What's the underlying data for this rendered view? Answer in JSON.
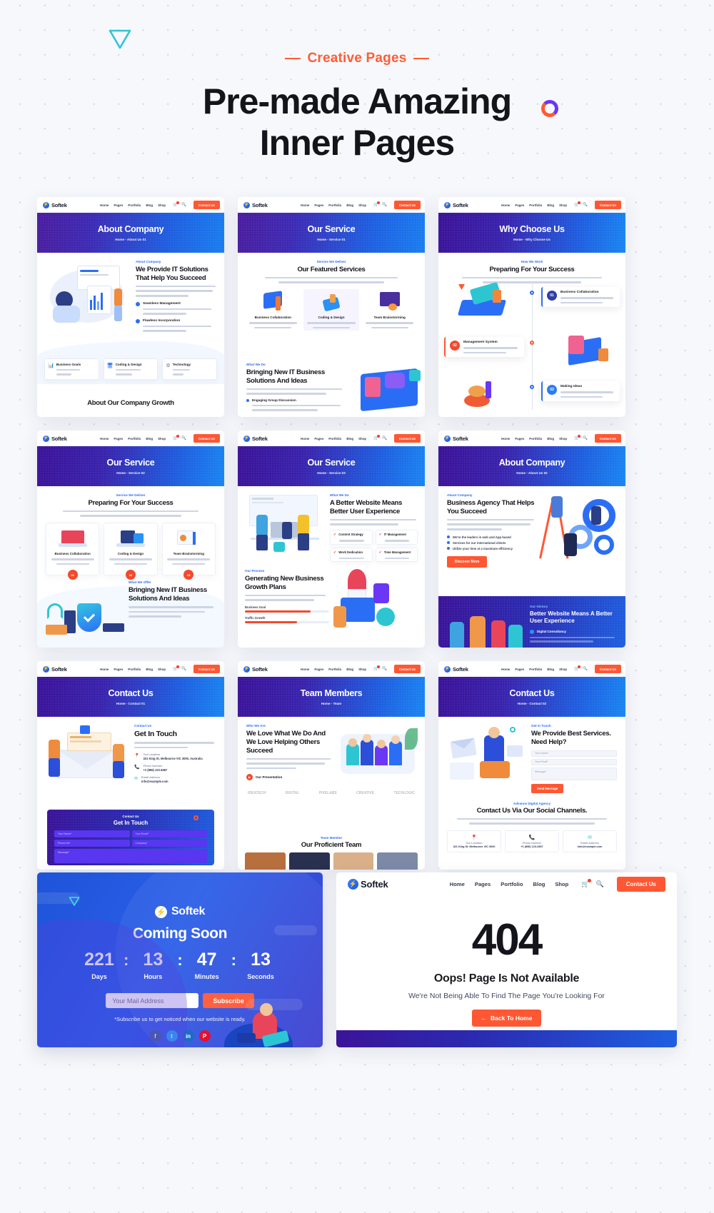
{
  "hero": {
    "eyebrow": "Creative Pages",
    "title_line1": "Pre-made Amazing",
    "title_line2": "Inner Pages"
  },
  "brand": {
    "name": "Softek",
    "accent": "#ff5733",
    "primary": "#2b6ef6",
    "deep": "#3b1398"
  },
  "mock_nav": {
    "items": [
      "Home",
      "Pages",
      "Portfolio",
      "Blog",
      "Shop"
    ],
    "cart_icon": "cart-icon",
    "search_icon": "search-icon",
    "cta": "Contact Us"
  },
  "cards": [
    {
      "id": "about-company-01",
      "banner_title": "About Company",
      "breadcrumb": "Home  -  About Us 01",
      "label": "About Company",
      "heading": "We Provide IT Solutions That Help You Succeed",
      "bullets": [
        "Seamless Management",
        "Flawless Incorporation"
      ],
      "boxes": [
        "Business Goals",
        "Coding & Design",
        "Technology"
      ],
      "footer_heading": "About Our Company Growth"
    },
    {
      "id": "our-service-01",
      "banner_title": "Our Service",
      "breadcrumb": "Home  -  Service 01",
      "label": "Service We Deliver",
      "heading": "Our Featured Services",
      "boxes": [
        "Business Collaboration",
        "Coding & Design",
        "Team Brainstorming"
      ],
      "sub_label": "What We Do",
      "sub_heading": "Bringing New IT Business Solutions And Ideas",
      "sub_bullet": "Engaging Group Discussion"
    },
    {
      "id": "why-choose-us",
      "banner_title": "Why Choose Us",
      "breadcrumb": "Home  -  Why Choose Us",
      "label": "How We Work",
      "heading": "Preparing For Your Success",
      "steps": [
        {
          "num": "01",
          "title": "Business Collaboration"
        },
        {
          "num": "02",
          "title": "Management System"
        },
        {
          "num": "03",
          "title": "Making Ideas"
        }
      ]
    },
    {
      "id": "our-service-02",
      "banner_title": "Our Service",
      "breadcrumb": "Home  -  Service 02",
      "label": "Service We Deliver",
      "heading": "Preparing For Your Success",
      "boxes": [
        "Business Collaboration",
        "Coding & Design",
        "Team Brainstorming"
      ],
      "box_nums": [
        "01",
        "02",
        "03"
      ],
      "sub_label": "What We Offer",
      "sub_heading": "Bringing New IT Business Solutions And Ideas"
    },
    {
      "id": "our-service-03",
      "banner_title": "Our Service",
      "breadcrumb": "Home  -  Service 03",
      "label": "What We Do",
      "heading": "A Better Website Means Better User Experience",
      "checks": [
        "Content Strategy",
        "IT Management",
        "Work Dedication",
        "Time Management"
      ],
      "sub_label": "Our Process",
      "sub_heading": "Generating New Business Growth Plans",
      "bars": [
        "Business Goal",
        "Traffic Growth"
      ]
    },
    {
      "id": "about-company-02",
      "banner_title": "About Company",
      "breadcrumb": "Home  -  About Us 02",
      "label": "About Company",
      "heading": "Business Agency That Helps You Succeed",
      "bullets": [
        "We're the leaders in web and App based",
        "Services for our international clients",
        "Utilize your time at a maximum efficiency"
      ],
      "button": "Discover More",
      "sub_label": "Our History",
      "sub_heading": "Better Website Means A Better User Experience",
      "sub_bullet": "Digital Consultancy"
    },
    {
      "id": "contact-us-01",
      "banner_title": "Contact Us",
      "breadcrumb": "Home  -  Contact 01",
      "label": "Contact Us",
      "heading": "Get In Touch",
      "contacts": [
        {
          "label": "Our Location",
          "value": "321 King St. Melbourne VIC 3000, Australia",
          "icon": "location-pin-icon"
        },
        {
          "label": "Phone Number",
          "value": "+1 (896) 123-4567",
          "icon": "phone-icon"
        },
        {
          "label": "Email Address",
          "value": "info@example.com",
          "icon": "envelope-icon"
        }
      ],
      "form_label": "Contact Us",
      "form_heading": "Get In Touch",
      "fields": [
        "Your Name*",
        "Your Email*",
        "Phone No*",
        "Company*",
        "Message*"
      ]
    },
    {
      "id": "team-members",
      "banner_title": "Team Members",
      "breadcrumb": "Home  -  Team",
      "label": "Who We Are",
      "heading": "We Love What We Do And We Love Helping Others Succeed",
      "bullet": "Our Presentation",
      "brands": [
        "IDEATECH",
        "DIGITAL",
        "PIXELABS",
        "CREATIVE",
        "TECHLOGIC"
      ],
      "sub_label": "Team Member",
      "sub_heading": "Our Proficient Team"
    },
    {
      "id": "contact-us-02",
      "banner_title": "Contact Us",
      "breadcrumb": "Home  -  Contact 02",
      "label": "Get In Touch",
      "heading": "We Provide Best Services. Need Help?",
      "fields": [
        "Your Name*",
        "Your Email*",
        "Message*"
      ],
      "button": "Send Message",
      "sub_label": "Advance Digital Agency",
      "sub_heading": "Contact Us Via Our Social Channels.",
      "contacts": [
        {
          "label": "Our Location",
          "value": "321 King St. Melbourne VIC 3000",
          "icon": "location-pin-icon"
        },
        {
          "label": "Phone Number",
          "value": "+1 (896) 123-4567",
          "icon": "phone-icon"
        },
        {
          "label": "Email Address",
          "value": "info@example.com",
          "icon": "envelope-icon"
        }
      ]
    }
  ],
  "coming_soon": {
    "brand": "Softek",
    "title": "Coming Soon",
    "counter": [
      {
        "num": "221",
        "label": "Days"
      },
      {
        "num": "13",
        "label": "Hours"
      },
      {
        "num": "47",
        "label": "Minutes"
      },
      {
        "num": "13",
        "label": "Seconds"
      }
    ],
    "separator": ":",
    "email_placeholder": "Your Mail Address",
    "subscribe_label": "Subscribe",
    "note": "*Subscribe us to get noticed when our website is ready.",
    "socials": [
      "f",
      "t",
      "in",
      "P"
    ]
  },
  "error_page": {
    "nav": {
      "items": [
        "Home",
        "Pages",
        "Portfolio",
        "Blog",
        "Shop"
      ],
      "cta": "Contact Us"
    },
    "code": "404",
    "heading": "Oops! Page Is Not Available",
    "text": "We're Not Being Able To Find The Page You're Looking For",
    "button": "Back To Home"
  }
}
